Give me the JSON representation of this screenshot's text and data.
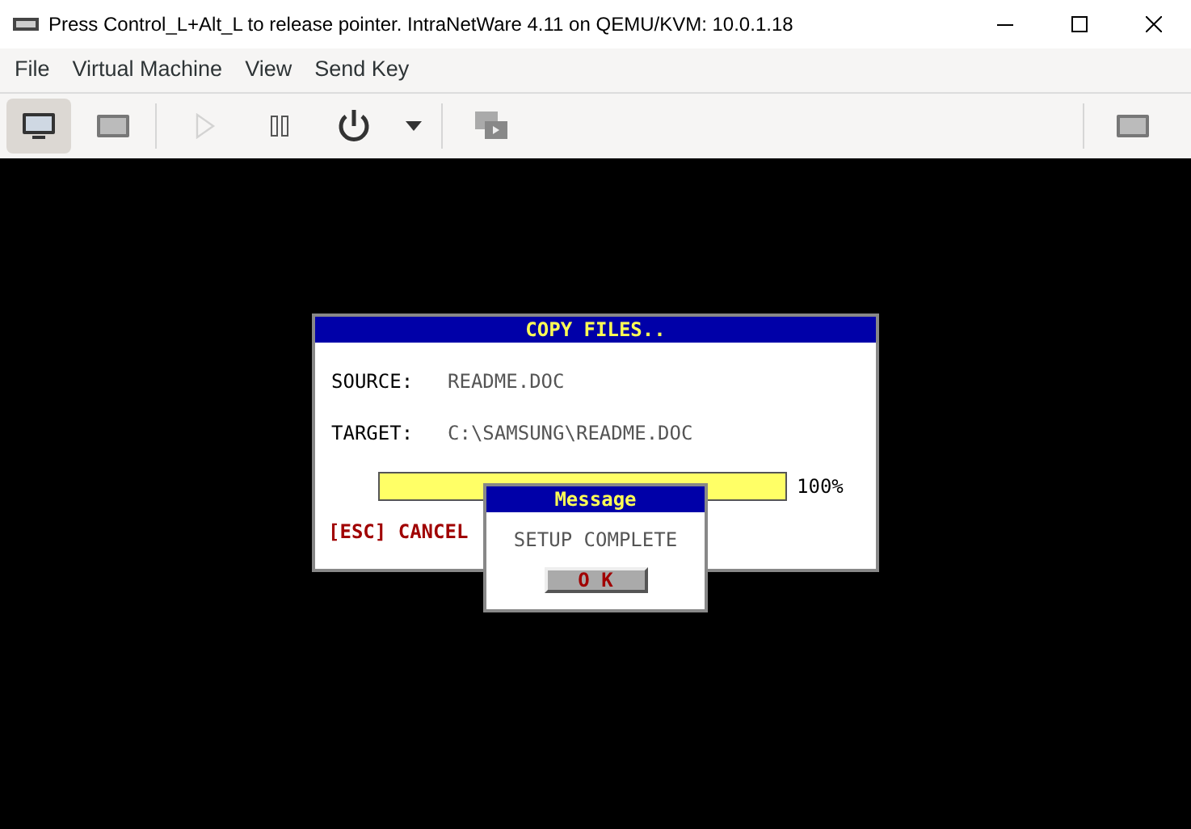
{
  "window": {
    "title": "Press Control_L+Alt_L to release pointer. IntraNetWare 4.11 on QEMU/KVM: 10.0.1.18"
  },
  "menu": [
    "File",
    "Virtual Machine",
    "View",
    "Send Key"
  ],
  "toolbar": [
    {
      "kind": "console",
      "selected": true,
      "disabled": false
    },
    {
      "kind": "details",
      "selected": false,
      "disabled": false
    },
    {
      "kind": "run",
      "selected": false,
      "disabled": true
    },
    {
      "kind": "pause",
      "selected": false,
      "disabled": false
    },
    {
      "kind": "power",
      "selected": false,
      "disabled": false
    },
    {
      "kind": "dropdown",
      "selected": false,
      "disabled": false
    },
    {
      "kind": "snapshots",
      "selected": false,
      "disabled": false
    },
    {
      "kind": "fullscreen",
      "selected": false,
      "disabled": false
    }
  ],
  "copy_dialog": {
    "title": "COPY FILES..",
    "fields": [
      {
        "label": "SOURCE:",
        "value": "README.DOC"
      },
      {
        "label": "TARGET:",
        "value": "C:\\SAMSUNG\\README.DOC"
      }
    ],
    "progress": {
      "level": 1,
      "reading": "100%"
    },
    "cancel": "[ESC] CANCEL"
  },
  "message": {
    "title": "Message",
    "text": "SETUP COMPLETE",
    "button": "O K"
  }
}
